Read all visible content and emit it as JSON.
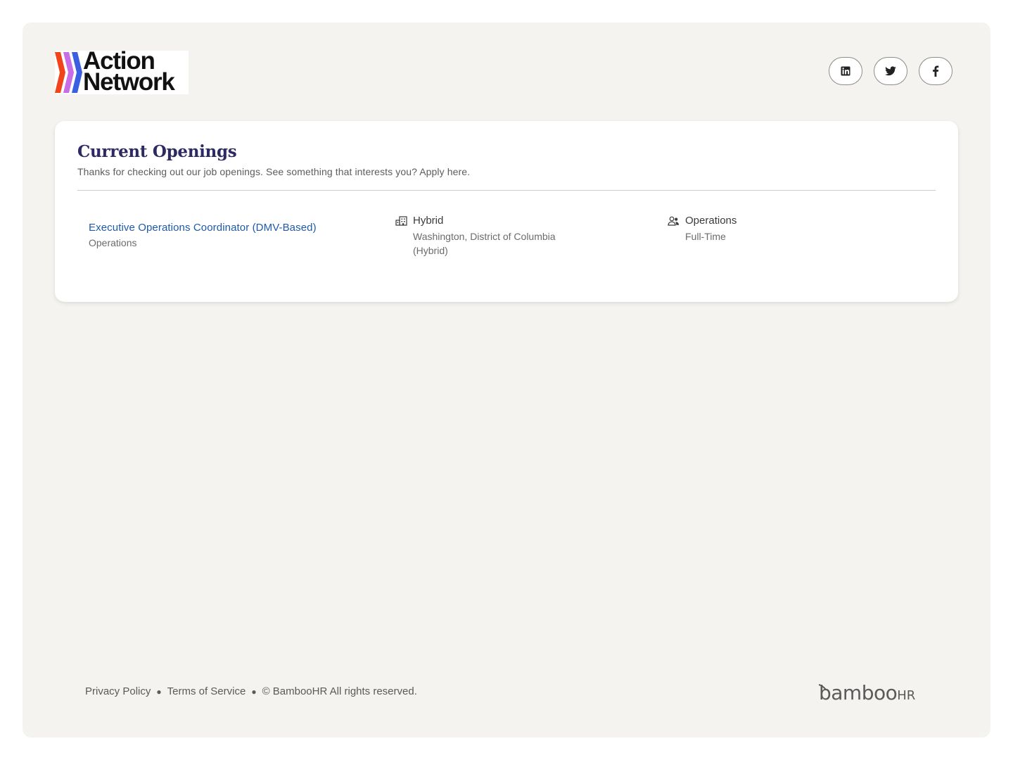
{
  "header": {
    "logo_line1": "Action",
    "logo_line2": "Network",
    "social": [
      {
        "name": "linkedin",
        "icon": "linkedin-icon"
      },
      {
        "name": "twitter",
        "icon": "twitter-icon"
      },
      {
        "name": "facebook",
        "icon": "facebook-icon"
      }
    ],
    "logo_colors": [
      "#f2441a",
      "#c86de5",
      "#3a5fe0"
    ]
  },
  "openings": {
    "title": "Current Openings",
    "subtitle": "Thanks for checking out our job openings. See something that interests you? Apply here.",
    "jobs": [
      {
        "title": "Executive Operations Coordinator (DMV-Based)",
        "department": "Operations",
        "location_type": "Hybrid",
        "location": "Washington, District of Columbia (Hybrid)",
        "team": "Operations",
        "employment_type": "Full-Time"
      }
    ]
  },
  "footer": {
    "privacy": "Privacy Policy",
    "terms": "Terms of Service",
    "copyright": "© BambooHR All rights reserved.",
    "brand_main": "bamboo",
    "brand_suffix": "HR"
  },
  "colors": {
    "accent_link": "#1e5aa8",
    "title": "#2d2a63",
    "frame_bg": "#f5f3f0"
  }
}
